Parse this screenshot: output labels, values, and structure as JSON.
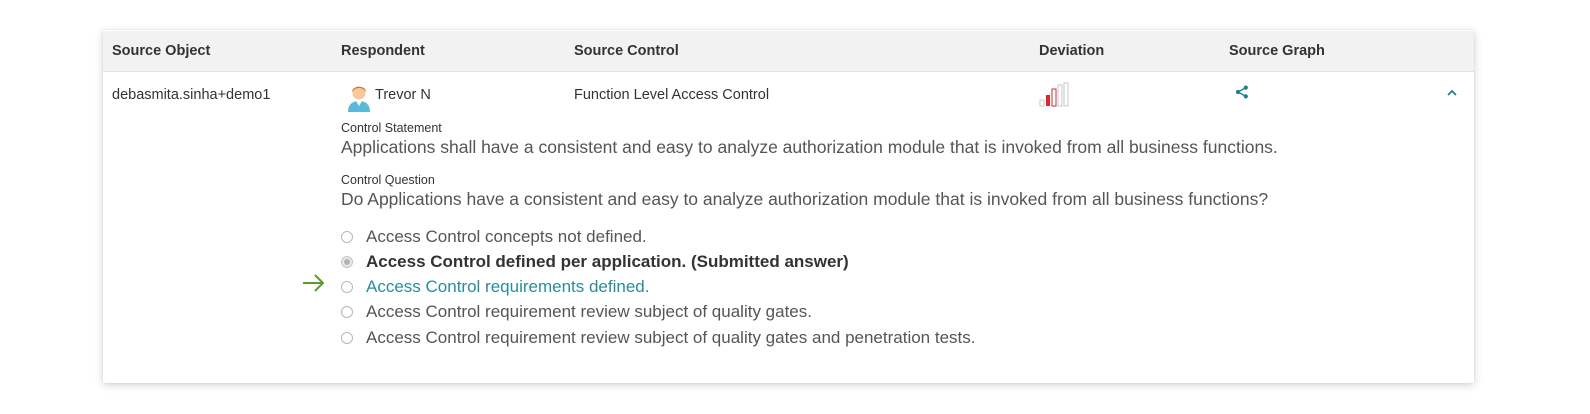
{
  "table": {
    "headers": {
      "source_object": "Source Object",
      "respondent": "Respondent",
      "source_control": "Source Control",
      "deviation": "Deviation",
      "source_graph": "Source Graph"
    },
    "row": {
      "source_object": "debasmita.sinha+demo1",
      "respondent": "Trevor N",
      "source_control": "Function Level Access Control",
      "deviation_icon": "deviation-bars-icon",
      "graph_icon": "share-icon",
      "expand_icon": "chevron-up-icon"
    }
  },
  "detail": {
    "control_statement_label": "Control Statement",
    "control_statement": "Applications shall have a consistent and easy to analyze authorization module that is invoked from all business functions.",
    "control_question_label": "Control Question",
    "control_question": "Do Applications have a consistent and easy to analyze authorization module that is invoked from all business functions?",
    "options": [
      {
        "label": "Access Control concepts not defined.",
        "state": "unselected"
      },
      {
        "label": "Access Control defined per application. (Submitted answer)",
        "state": "submitted"
      },
      {
        "label": "Access Control requirements defined.",
        "state": "highlighted"
      },
      {
        "label": "Access Control requirement review subject of quality gates.",
        "state": "unselected"
      },
      {
        "label": "Access Control requirement review subject of quality gates and penetration tests.",
        "state": "unselected"
      }
    ],
    "arrow_icon": "arrow-right-icon"
  },
  "colors": {
    "header_bg": "#f2f2f2",
    "highlight_text": "#2b8c99",
    "arrow": "#5a9a32",
    "deviation_red": "#d62b2b",
    "share_icon": "#1f7e8c"
  }
}
